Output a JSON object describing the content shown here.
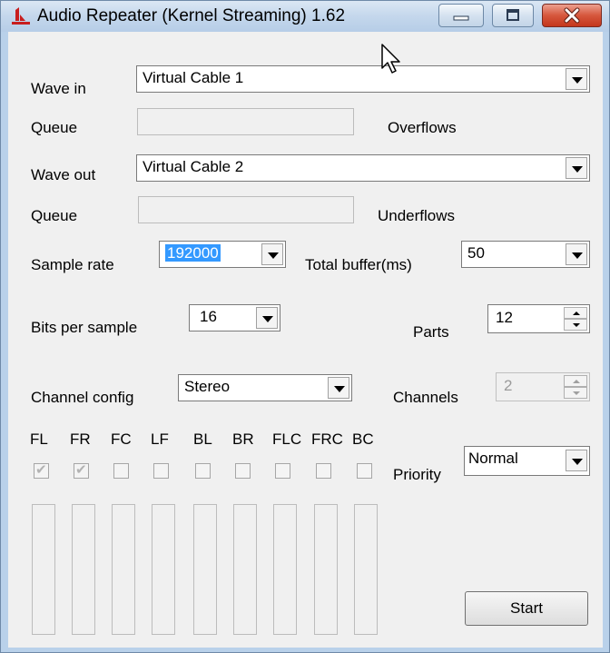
{
  "window": {
    "title": "Audio Repeater (Kernel Streaming) 1.62"
  },
  "wave_in": {
    "label": "Wave in",
    "value": "Virtual Cable 1"
  },
  "wave_in_queue": {
    "label": "Queue",
    "status_label": "Overflows"
  },
  "wave_out": {
    "label": "Wave out",
    "value": "Virtual Cable 2"
  },
  "wave_out_queue": {
    "label": "Queue",
    "status_label": "Underflows"
  },
  "sample_rate": {
    "label": "Sample rate",
    "value": "192000"
  },
  "total_buffer": {
    "label": "Total buffer(ms)",
    "value": "50"
  },
  "bits_per_sample": {
    "label": "Bits per sample",
    "value": "16"
  },
  "parts": {
    "label": "Parts",
    "value": "12"
  },
  "channel_config": {
    "label": "Channel config",
    "value": "Stereo"
  },
  "channels": {
    "label": "Channels",
    "value": "2"
  },
  "speakers": [
    {
      "label": "FL",
      "checked": true
    },
    {
      "label": "FR",
      "checked": true
    },
    {
      "label": "FC",
      "checked": false
    },
    {
      "label": "LF",
      "checked": false
    },
    {
      "label": "BL",
      "checked": false
    },
    {
      "label": "BR",
      "checked": false
    },
    {
      "label": "FLC",
      "checked": false
    },
    {
      "label": "FRC",
      "checked": false
    },
    {
      "label": "BC",
      "checked": false
    }
  ],
  "priority": {
    "label": "Priority",
    "value": "Normal"
  },
  "start_label": "Start",
  "colors": {
    "titlebar": "#c4d7ec",
    "client": "#f0f0f0",
    "selection": "#3399ff",
    "close": "#c4361c"
  }
}
